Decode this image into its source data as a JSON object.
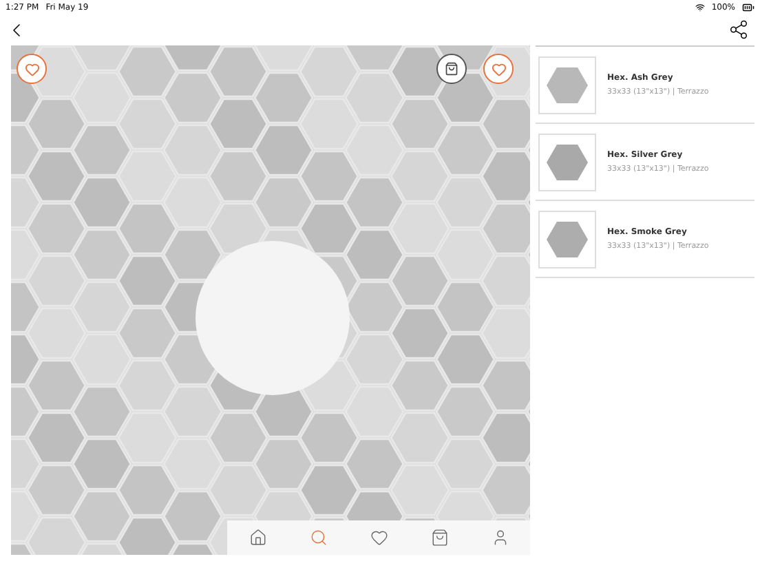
{
  "status_bar": {
    "time": "1:27 PM",
    "date": "Fri May 19",
    "battery": "100%"
  },
  "products": [
    {
      "name": "Hex. Ash Grey",
      "details": "33x33 (13\"x13\") | Terrazzo"
    },
    {
      "name": "Hex. Silver Grey",
      "details": "33x33 (13\"x13\") | Terrazzo"
    },
    {
      "name": "Hex. Smoke Grey",
      "details": "33x33 (13\"x13\") | Terrazzo"
    }
  ],
  "tab_bar": [
    {
      "kind": "home",
      "selected": false
    },
    {
      "kind": "search",
      "selected": true
    },
    {
      "kind": "favorites",
      "selected": false
    },
    {
      "kind": "bag",
      "selected": false
    },
    {
      "kind": "profile",
      "selected": false
    }
  ]
}
